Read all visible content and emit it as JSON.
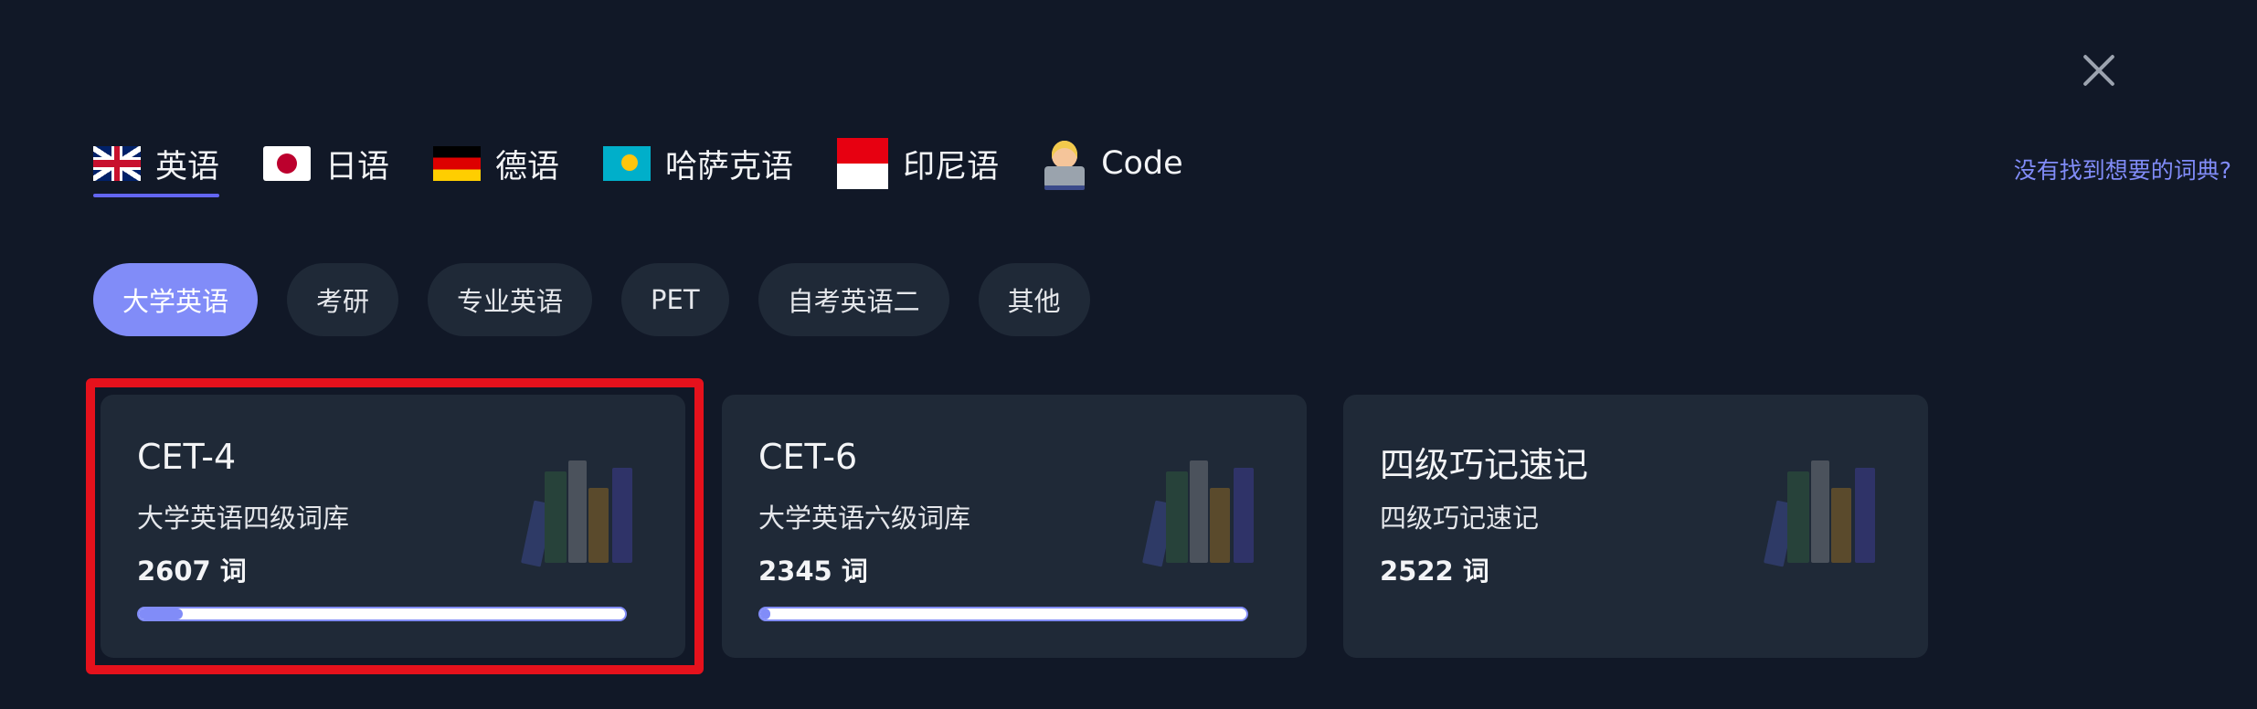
{
  "language_tabs": [
    {
      "label": "英语",
      "flag": "uk-flag-icon",
      "active": true
    },
    {
      "label": "日语",
      "flag": "japan-flag-icon",
      "active": false
    },
    {
      "label": "德语",
      "flag": "germany-flag-icon",
      "active": false
    },
    {
      "label": "哈萨克语",
      "flag": "kazakhstan-flag-icon",
      "active": false
    },
    {
      "label": "印尼语",
      "flag": "indonesia-flag-icon",
      "active": false
    },
    {
      "label": "Code",
      "flag": "technologist-emoji-icon",
      "active": false
    }
  ],
  "missing_dict_link": "没有找到想要的词典?",
  "category_chips": [
    {
      "label": "大学英语",
      "active": true
    },
    {
      "label": "考研",
      "active": false
    },
    {
      "label": "专业英语",
      "active": false
    },
    {
      "label": "PET",
      "active": false
    },
    {
      "label": "自考英语二",
      "active": false
    },
    {
      "label": "其他",
      "active": false
    }
  ],
  "cards": [
    {
      "title": "CET-4",
      "description": "大学英语四级词库",
      "count": "2607 词",
      "progress": 0.09,
      "selected": true
    },
    {
      "title": "CET-6",
      "description": "大学英语六级词库",
      "count": "2345 词",
      "progress": 0.02,
      "selected": false
    },
    {
      "title": "四级巧记速记",
      "description": "四级巧记速记",
      "count": "2522 词",
      "progress": null,
      "selected": false
    }
  ],
  "colors": {
    "background": "#111827",
    "card": "#1f2937",
    "accent": "#818cf8",
    "highlight": "#e5111c"
  },
  "icons": {
    "close": "close-icon",
    "books": "books-icon"
  }
}
